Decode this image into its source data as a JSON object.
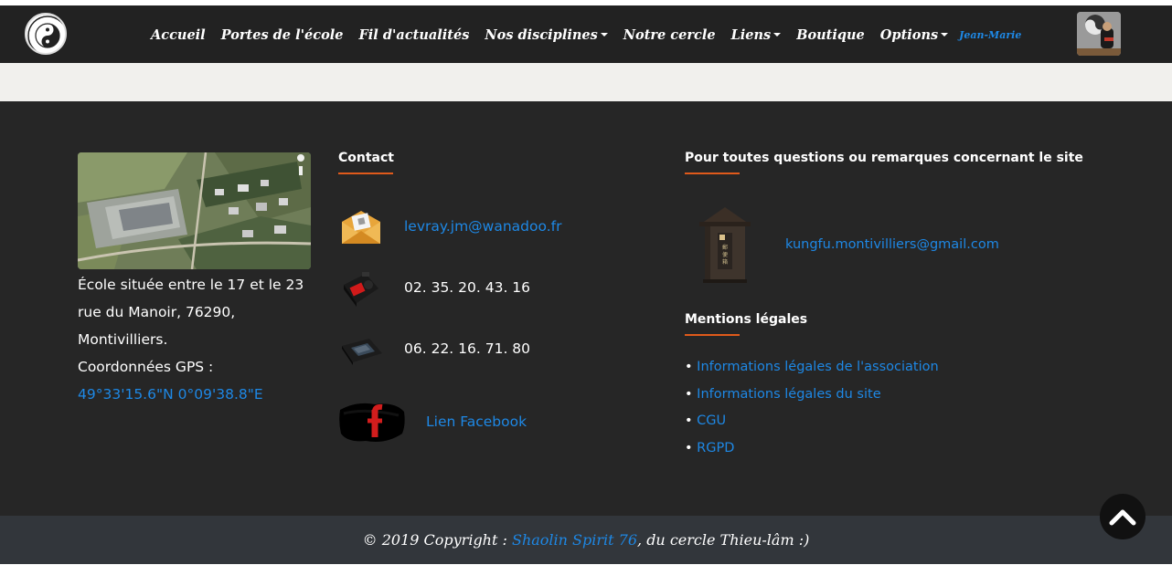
{
  "nav": {
    "logo_icon": "yin-yang-logo-icon",
    "items": [
      {
        "label": "Accueil",
        "dropdown": false
      },
      {
        "label": "Portes de l'école",
        "dropdown": false
      },
      {
        "label": "Fil d'actualités",
        "dropdown": false
      },
      {
        "label": "Nos disciplines",
        "dropdown": true
      },
      {
        "label": "Notre cercle",
        "dropdown": false
      },
      {
        "label": "Liens",
        "dropdown": true
      },
      {
        "label": "Boutique",
        "dropdown": false
      },
      {
        "label": "Options",
        "dropdown": true
      }
    ],
    "user": "Jean-Marie",
    "avatar_icon": "user-avatar-icon"
  },
  "location": {
    "map_icon": "aerial-map-icon",
    "address_line1": "École située entre le 17 et le 23",
    "address_line2": "rue du Manoir, 76290,",
    "address_line3": "Montivilliers.",
    "gps_label": "Coordonnées GPS :",
    "gps_value": "49°33'15.6\"N 0°09'38.8\"E"
  },
  "contact": {
    "heading": "Contact",
    "email": "levray.jm@wanadoo.fr",
    "phone_fixed": "02. 35. 20. 43. 16",
    "phone_mobile": "06. 22. 16. 71. 80",
    "facebook": "Lien Facebook"
  },
  "site": {
    "heading": "Pour toutes questions ou remarques concernant le site",
    "email": "kungfu.montivilliers@gmail.com",
    "legal_heading": "Mentions légales",
    "legal_links": [
      "Informations légales de l'association",
      "Informations légales du site",
      "CGU",
      "RGPD"
    ]
  },
  "footer": {
    "copyright_prefix": "© 2019 Copyright : ",
    "brand": "Shaolin Spirit 76",
    "copyright_suffix": ", du cercle Thieu-lâm :)"
  },
  "colors": {
    "navbar": "#222222",
    "footer": "#262626",
    "bottombar": "#32363b",
    "link": "#1e88e5",
    "accent": "#e05a1b"
  }
}
